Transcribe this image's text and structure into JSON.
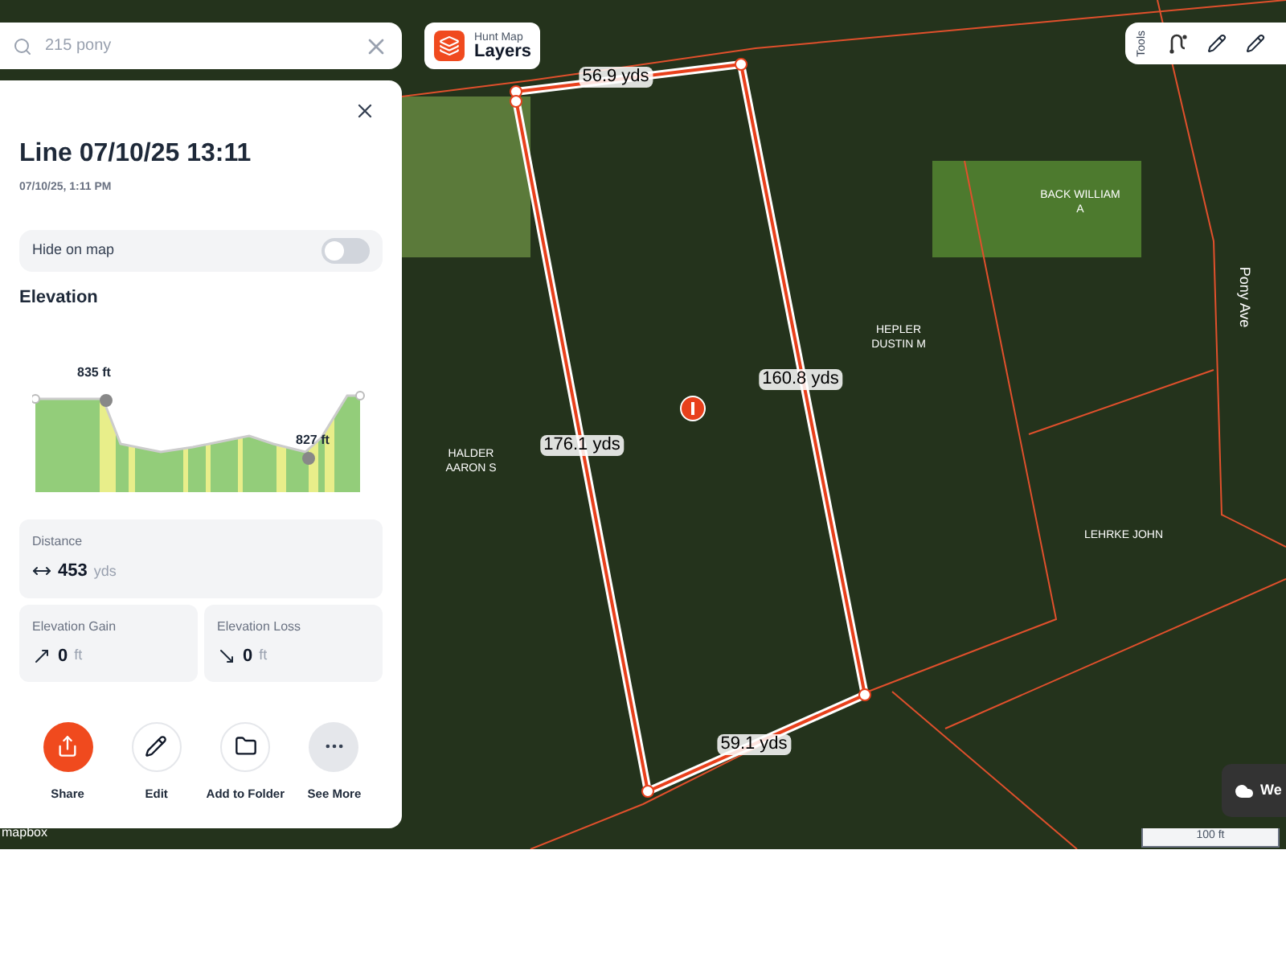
{
  "search": {
    "placeholder": "215 pony"
  },
  "layers_button": {
    "caption": "Hunt Map",
    "label": "Layers"
  },
  "tools": {
    "label": "Tools"
  },
  "panel": {
    "title": "Line 07/10/25 13:11",
    "subtitle": "07/10/25, 1:11 PM",
    "hide_on_map": {
      "label": "Hide on map",
      "on": false
    },
    "elevation": {
      "heading": "Elevation",
      "max_label": "835 ft",
      "min_label": "827 ft"
    },
    "stats": [
      {
        "kind": "distance",
        "label": "Distance",
        "value": "453",
        "unit": "yds"
      },
      {
        "kind": "gain",
        "label": "Elevation Gain",
        "value": "0",
        "unit": "ft"
      },
      {
        "kind": "loss",
        "label": "Elevation Loss",
        "value": "0",
        "unit": "ft"
      }
    ],
    "actions": [
      {
        "kind": "share",
        "label": "Share"
      },
      {
        "kind": "edit",
        "label": "Edit"
      },
      {
        "kind": "folder",
        "label": "Add to Folder"
      },
      {
        "kind": "more",
        "label": "See More"
      }
    ]
  },
  "map": {
    "measurements": [
      "56.9 yds",
      "160.8 yds",
      "176.1 yds",
      "59.1 yds"
    ],
    "parcels": [
      "BACK WILLIAM A",
      "HEPLER DUSTIN M",
      "HALDER AARON S",
      "LEHRKE JOHN"
    ],
    "road": "Pony Ave",
    "weather": "We",
    "scale": "100 ft",
    "attribution": "mapbox"
  }
}
